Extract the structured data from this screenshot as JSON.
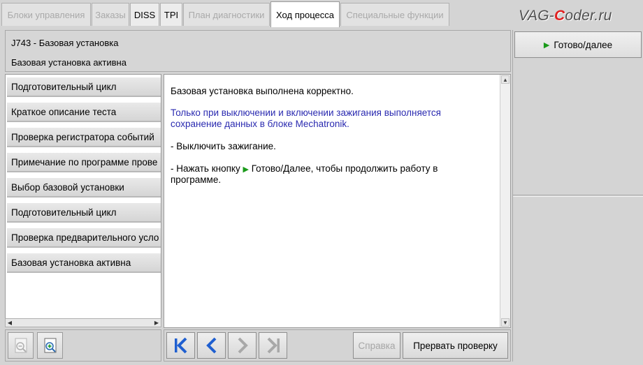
{
  "tabs": [
    {
      "label": "Блоки управления",
      "state": "disabled"
    },
    {
      "label": "Заказы",
      "state": "disabled"
    },
    {
      "label": "DISS",
      "state": "enabled"
    },
    {
      "label": "TPI",
      "state": "enabled"
    },
    {
      "label": "План диагностики",
      "state": "disabled"
    },
    {
      "label": "Ход процесса",
      "state": "active"
    },
    {
      "label": "Специальные функции",
      "state": "disabled"
    }
  ],
  "logo": {
    "prefix": "VAG-",
    "accent": "C",
    "suffix": "oder.ru",
    "accent_color": "#e02020"
  },
  "header": {
    "title": "J743 - Базовая установка",
    "subtitle": "Базовая установка активна"
  },
  "steps": [
    "Подготовительный цикл",
    "Краткое описание теста",
    "Проверка регистратора событий",
    "Примечание по программе прове",
    "Выбор базовой установки",
    "Подготовительный цикл",
    "Проверка предварительного усло",
    "Базовая установка активна"
  ],
  "content": {
    "line1": "Базовая установка выполнена корректно.",
    "notice_line1": "Только при выключении и включении зажигания выполняется",
    "notice_line2": "сохранение данных в блоке Mechatronik.",
    "instr1": "- Выключить зажигание.",
    "instr2_before": "- Нажать кнопку",
    "instr2_after": "Готово/Далее, чтобы продолжить работу в",
    "instr2_line2": "программе."
  },
  "right_panel": {
    "ready_label": "Готово/далее"
  },
  "toolbar": {
    "help_label": "Справка",
    "abort_label": "Прервать проверку"
  },
  "colors": {
    "accent_green": "#1a9a1a",
    "notice_blue": "#2a2ab0",
    "nav_blue": "#1f5fd0",
    "nav_disabled": "#a8a8a8"
  }
}
